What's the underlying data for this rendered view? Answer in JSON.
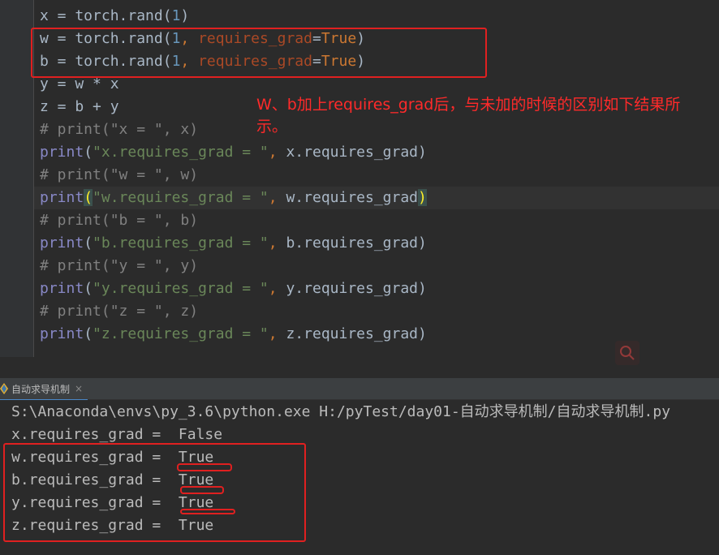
{
  "editor": {
    "lines": [
      {
        "k": "plain",
        "parts": [
          [
            "x = torch.rand(",
            ""
          ],
          [
            "1",
            "num"
          ],
          [
            ")",
            ""
          ]
        ]
      },
      {
        "k": "plain",
        "parts": [
          [
            "w = torch.rand(",
            ""
          ],
          [
            "1",
            "num"
          ],
          [
            ", ",
            "kw"
          ],
          [
            "requires_grad",
            "param"
          ],
          [
            "=",
            ""
          ],
          [
            "True",
            "bool"
          ],
          [
            ")",
            ""
          ]
        ]
      },
      {
        "k": "plain",
        "parts": [
          [
            "b = torch.rand(",
            ""
          ],
          [
            "1",
            "num"
          ],
          [
            ", ",
            "kw"
          ],
          [
            "requires_grad",
            "param"
          ],
          [
            "=",
            ""
          ],
          [
            "True",
            "bool"
          ],
          [
            ")",
            ""
          ]
        ]
      },
      {
        "k": "plain",
        "parts": [
          [
            "y = w * x",
            ""
          ]
        ]
      },
      {
        "k": "plain",
        "parts": [
          [
            "z = b + y",
            ""
          ]
        ]
      },
      {
        "k": "plain",
        "parts": [
          [
            "# print(\"x = \", x)",
            "com"
          ]
        ]
      },
      {
        "k": "plain",
        "parts": [
          [
            "print",
            "fn"
          ],
          [
            "(",
            ""
          ],
          [
            "\"x.requires_grad = \"",
            "str"
          ],
          [
            ", ",
            "kw"
          ],
          [
            "x.requires_grad)",
            ""
          ]
        ]
      },
      {
        "k": "plain",
        "parts": [
          [
            "# print(\"w = \", w)",
            "com"
          ]
        ]
      },
      {
        "k": "plain",
        "parts": [
          [
            "print",
            "fn"
          ],
          [
            "(",
            "brace"
          ],
          [
            "\"w.requires_grad = \"",
            "str"
          ],
          [
            ", ",
            "kw"
          ],
          [
            "w.requires_grad",
            ""
          ],
          [
            ")",
            "brace"
          ]
        ]
      },
      {
        "k": "plain",
        "parts": [
          [
            "# print(\"b = \", b)",
            "com"
          ]
        ]
      },
      {
        "k": "plain",
        "parts": [
          [
            "print",
            "fn"
          ],
          [
            "(",
            ""
          ],
          [
            "\"b.requires_grad = \"",
            "str"
          ],
          [
            ", ",
            "kw"
          ],
          [
            "b.requires_grad)",
            ""
          ]
        ]
      },
      {
        "k": "plain",
        "parts": [
          [
            "# print(\"y = \", y)",
            "com"
          ]
        ]
      },
      {
        "k": "plain",
        "parts": [
          [
            "print",
            "fn"
          ],
          [
            "(",
            ""
          ],
          [
            "\"y.requires_grad = \"",
            "str"
          ],
          [
            ", ",
            "kw"
          ],
          [
            "y.requires_grad)",
            ""
          ]
        ]
      },
      {
        "k": "plain",
        "parts": [
          [
            "# print(\"z = \", z)",
            "com"
          ]
        ]
      },
      {
        "k": "plain",
        "parts": [
          [
            "print",
            "fn"
          ],
          [
            "(",
            ""
          ],
          [
            "\"z.requires_grad = \"",
            "str"
          ],
          [
            ", ",
            "kw"
          ],
          [
            "z.requires_grad)",
            ""
          ]
        ]
      }
    ]
  },
  "annotation": "W、b加上requires_grad后，与未加的时候的区别如下结果所示。",
  "run_tab": {
    "label": "自动求导机制",
    "close": "×"
  },
  "console": {
    "lines": [
      "S:\\Anaconda\\envs\\py_3.6\\python.exe H:/pyTest/day01-自动求导机制/自动求导机制.py",
      "x.requires_grad =  False",
      "w.requires_grad =  True",
      "b.requires_grad =  True",
      "y.requires_grad =  True",
      "z.requires_grad =  True"
    ]
  },
  "colors": {
    "background": "#2b2b2b",
    "annotation_red": "#e02020",
    "accent_blue": "#4a88c7"
  }
}
